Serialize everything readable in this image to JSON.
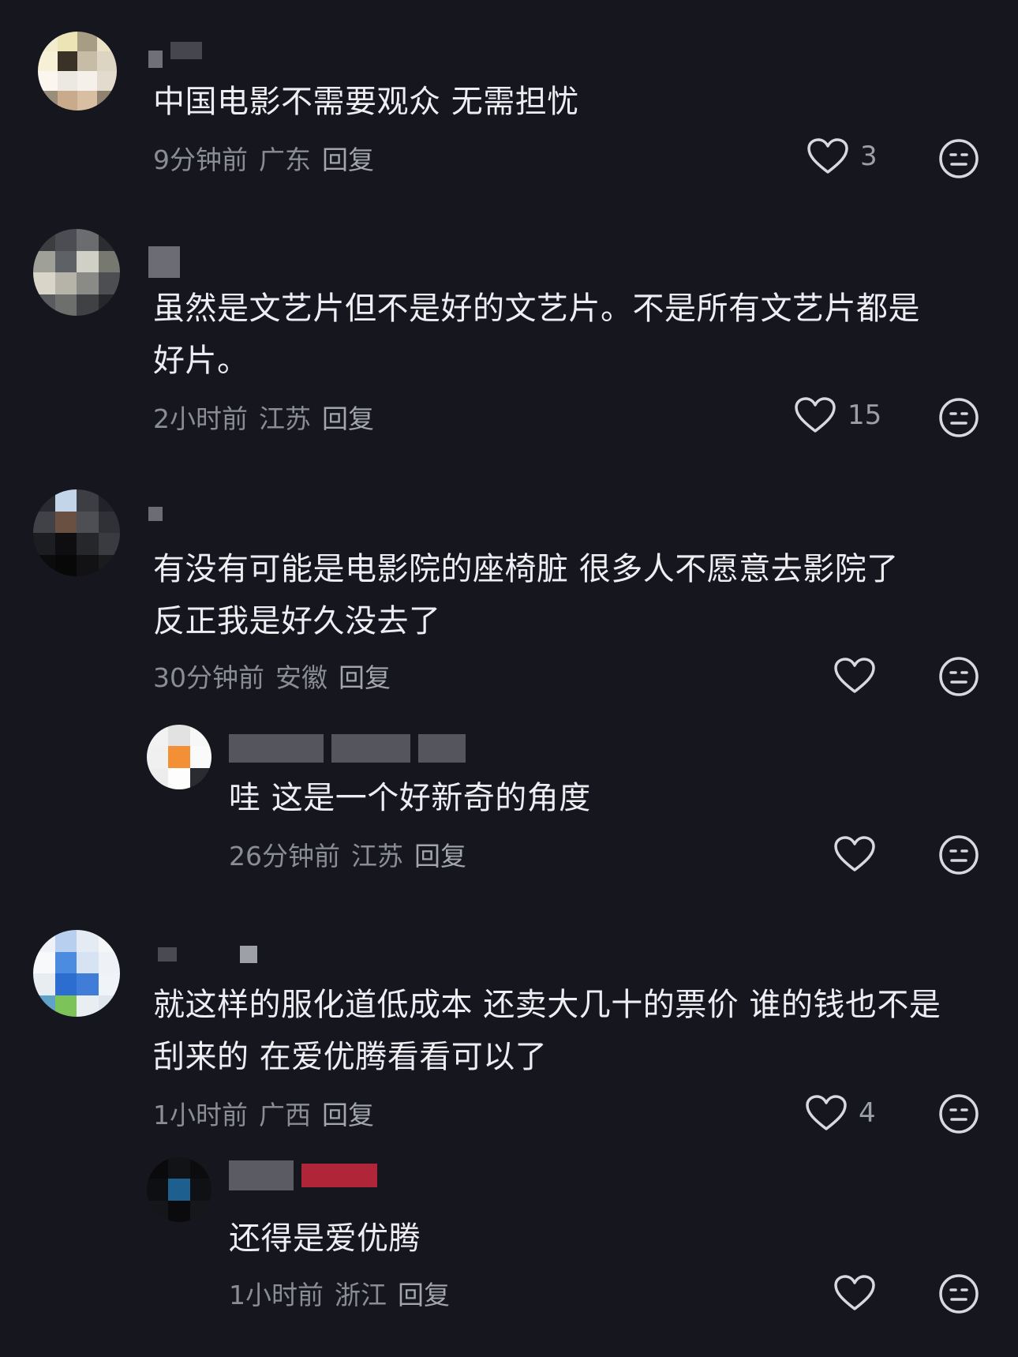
{
  "comments": [
    {
      "text": "中国电影不需要观众 无需担忧",
      "time": "9分钟前",
      "location": "广东",
      "reply": "回复",
      "likes": "3"
    },
    {
      "text_line1": "虽然是文艺片但不是好的文艺片。不是所有文艺片都是",
      "text_line2": "好片。",
      "time": "2小时前",
      "location": "江苏",
      "reply": "回复",
      "likes": "15"
    },
    {
      "text_line1": "有没有可能是电影院的座椅脏 很多人不愿意去影院了",
      "text_line2": "反正我是好久没去了",
      "time": "30分钟前",
      "location": "安徽",
      "reply": "回复",
      "likes": ""
    },
    {
      "text": "哇 这是一个好新奇的角度",
      "time": "26分钟前",
      "location": "江苏",
      "reply": "回复",
      "likes": ""
    },
    {
      "text_line1": "就这样的服化道低成本 还卖大几十的票价 谁的钱也不是",
      "text_line2": "刮来的 在爱优腾看看可以了",
      "time": "1小时前",
      "location": "广西",
      "reply": "回复",
      "likes": "4"
    },
    {
      "text": "还得是爱优腾",
      "time": "1小时前",
      "location": "浙江",
      "reply": "回复",
      "likes": ""
    }
  ],
  "icons": {
    "like": "heart-outline-icon",
    "dislike": "neutral-face-icon"
  },
  "colors": {
    "background": "#15161e",
    "text": "#eeeef2",
    "meta": "#8a8c96"
  }
}
